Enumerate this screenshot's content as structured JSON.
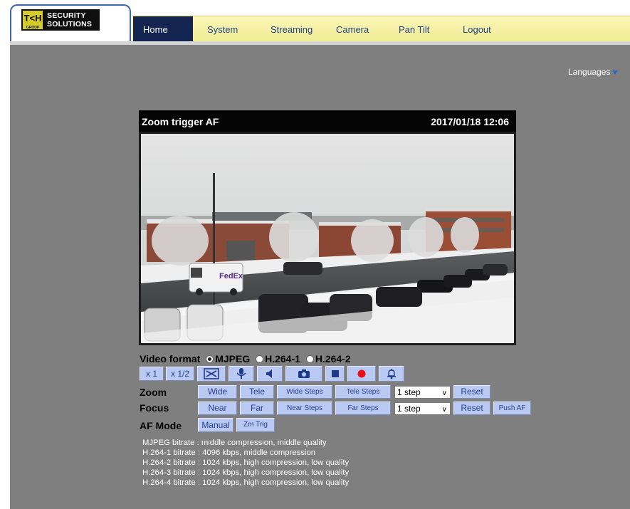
{
  "logo": {
    "mark": "T<H",
    "mark_sub": "GROUP",
    "line1": "SECURITY",
    "line2": "SOLUTIONS"
  },
  "nav": {
    "items": [
      {
        "label": "Home",
        "active": true
      },
      {
        "label": "System"
      },
      {
        "label": "Streaming"
      },
      {
        "label": "Camera"
      },
      {
        "label": "Pan Tilt"
      },
      {
        "label": "Logout"
      }
    ]
  },
  "languages": {
    "label": "Languages"
  },
  "video": {
    "title": "Zoom trigger AF",
    "timestamp": "2017/01/18 12:06",
    "truck_logo": "FedEx"
  },
  "video_format": {
    "label": "Video format",
    "options": [
      "MJPEG",
      "H.264-1",
      "H.264-2"
    ],
    "selected": "MJPEG"
  },
  "toolbar": {
    "x1": "x 1",
    "x_half": "x 1/2",
    "fullscreen_icon": "fullscreen-icon",
    "mic_icon": "microphone-icon",
    "speaker_icon": "speaker-icon",
    "snapshot_icon": "camera-icon",
    "stop_icon": "stop-icon",
    "record_icon": "record-icon",
    "alarm_icon": "bell-icon",
    "record_color": "#e8101a"
  },
  "zoom": {
    "label": "Zoom",
    "wide": "Wide",
    "tele": "Tele",
    "wide_steps": "Wide Steps",
    "tele_steps": "Tele Steps",
    "step_value": "1 step",
    "reset": "Reset"
  },
  "focus": {
    "label": "Focus",
    "near": "Near",
    "far": "Far",
    "near_steps": "Near Steps",
    "far_steps": "Far Steps",
    "step_value": "1 step",
    "reset": "Reset",
    "push_af": "Push AF"
  },
  "af_mode": {
    "label": "AF Mode",
    "manual": "Manual",
    "zm_trig": "Zm Trig"
  },
  "bitrates": [
    "MJPEG bitrate : middle compression, middle quality",
    "H.264-1 bitrate : 4096 kbps, middle compression",
    "H.264-2 bitrate : 1024 kbps, high compression, low quality",
    "H.264-3 bitrate : 1024 kbps, high compression, low quality",
    "H.264-4 bitrate : 1024 kbps, high compression, low quality"
  ],
  "colors": {
    "nav_active": "#12244f",
    "nav_bg": "#f1ec95",
    "button_bg": "#b9c9f1",
    "page_bg": "#7f7f7f"
  }
}
